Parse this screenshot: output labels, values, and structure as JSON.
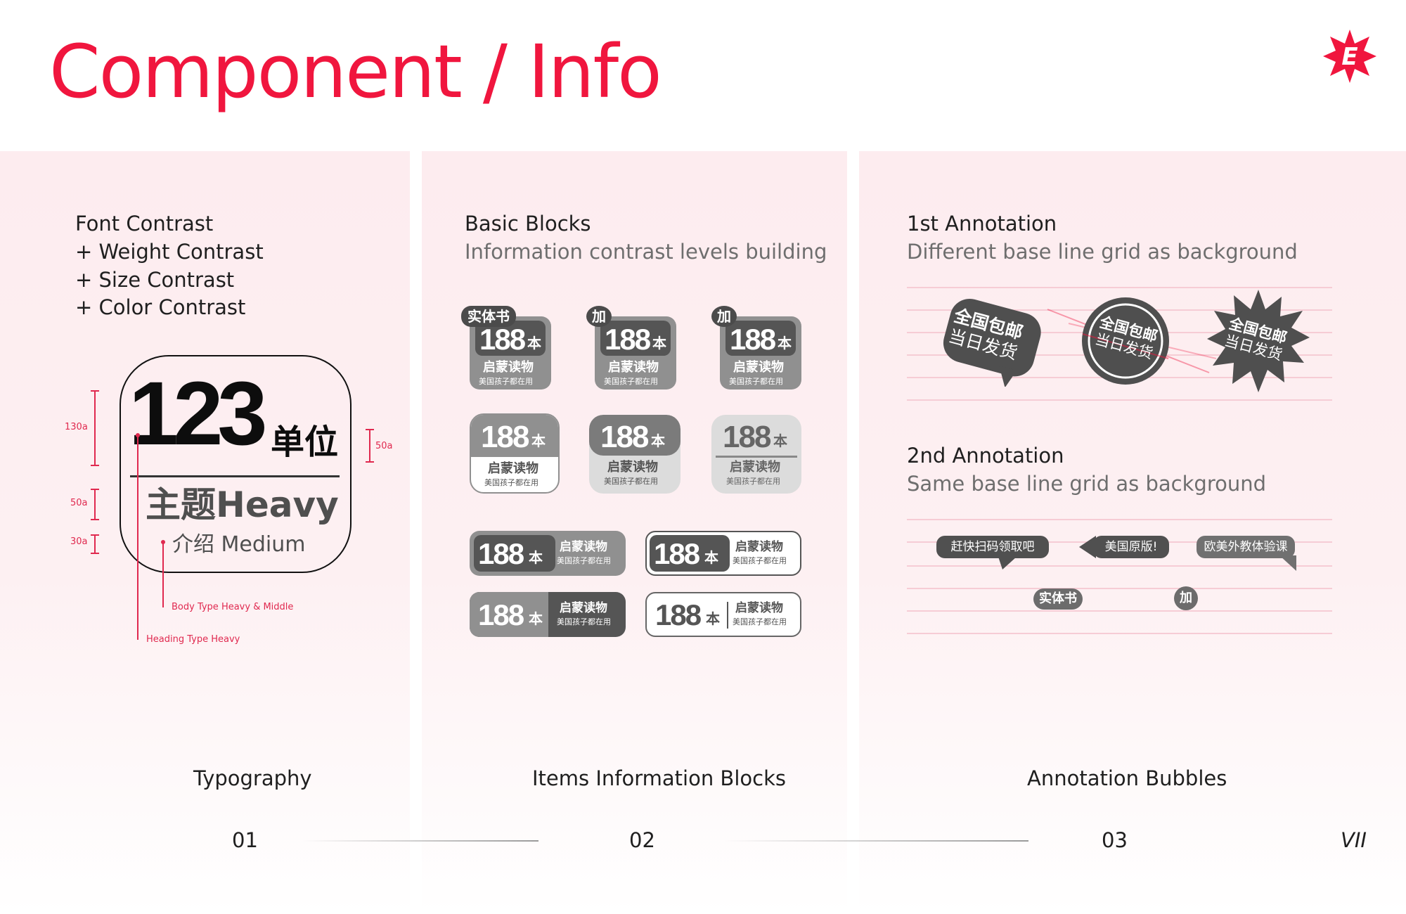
{
  "header": {
    "title": "Component / Info",
    "logo_letter": "E",
    "brand_color": "#f0163e"
  },
  "typography": {
    "lines": [
      "Font Contrast",
      "+ Weight Contrast",
      "+ Size Contrast",
      "+ Color Contrast"
    ],
    "big_number": "123",
    "big_unit": "单位",
    "heavy_text": "主题Heavy",
    "medium_text": "介绍 Medium",
    "dim_130": "130a",
    "dim_50_left": "50a",
    "dim_30": "30a",
    "dim_50_right": "50a",
    "note_body": "Body Type Heavy & Middle",
    "note_heading": "Heading Type Heavy",
    "footer_label": "Typography",
    "footer_num": "01"
  },
  "blocks": {
    "title": "Basic Blocks",
    "subtitle": "Information contrast levels building",
    "tag_physical": "实体书",
    "tag_add": "加",
    "tag_add2": "加",
    "number": "188",
    "unit": "本",
    "line1": "启蒙读物",
    "line2": "美国孩子都在用",
    "footer_label": "Items Information Blocks",
    "footer_num": "02"
  },
  "annotation": {
    "first_title": "1st Annotation",
    "first_sub": "Different base line grid as background",
    "sticker_top": "全国包邮",
    "sticker_bottom": "当日发货",
    "second_title": "2nd Annotation",
    "second_sub": "Same base line grid as background",
    "bubble1": "赶快扫码领取吧",
    "bubble2": "美国原版!",
    "bubble3": "欧美外教体验课",
    "pill1": "实体书",
    "pill2": "加",
    "footer_label": "Annotation Bubbles",
    "footer_num": "03"
  },
  "page_number": "VII"
}
